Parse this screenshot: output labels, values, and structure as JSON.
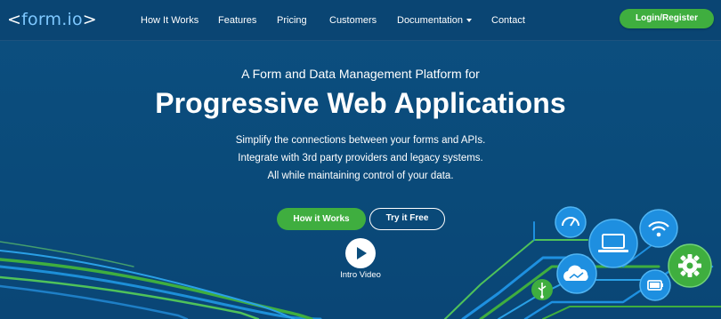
{
  "logo": {
    "prefix": "<",
    "accent": "form.io",
    "suffix": ">"
  },
  "nav": {
    "items": [
      {
        "label": "How It Works"
      },
      {
        "label": "Features"
      },
      {
        "label": "Pricing"
      },
      {
        "label": "Customers"
      },
      {
        "label": "Documentation"
      },
      {
        "label": "Contact"
      }
    ],
    "login_label": "Login/Register"
  },
  "hero": {
    "eyebrow": "A Form and Data Management Platform for",
    "headline": "Progressive Web Applications",
    "sub_lines": [
      "Simplify the connections between your forms and APIs.",
      "Integrate with 3rd party providers and legacy systems.",
      "All while maintaining control of your data."
    ],
    "cta_primary": "How it Works",
    "cta_secondary": "Try it Free",
    "video_label": "Intro Video"
  },
  "illustration": {
    "icons": [
      "gauge-icon",
      "laptop-icon",
      "wifi-icon",
      "cloud-icon",
      "gear-icon",
      "usb-icon",
      "battery-icon"
    ]
  },
  "colors": {
    "background": "#0b4d7c",
    "navbar": "#0a4573",
    "accent_green": "#3fae3f",
    "accent_blue": "#1e90e0",
    "logo_accent": "#7ec8ff"
  }
}
